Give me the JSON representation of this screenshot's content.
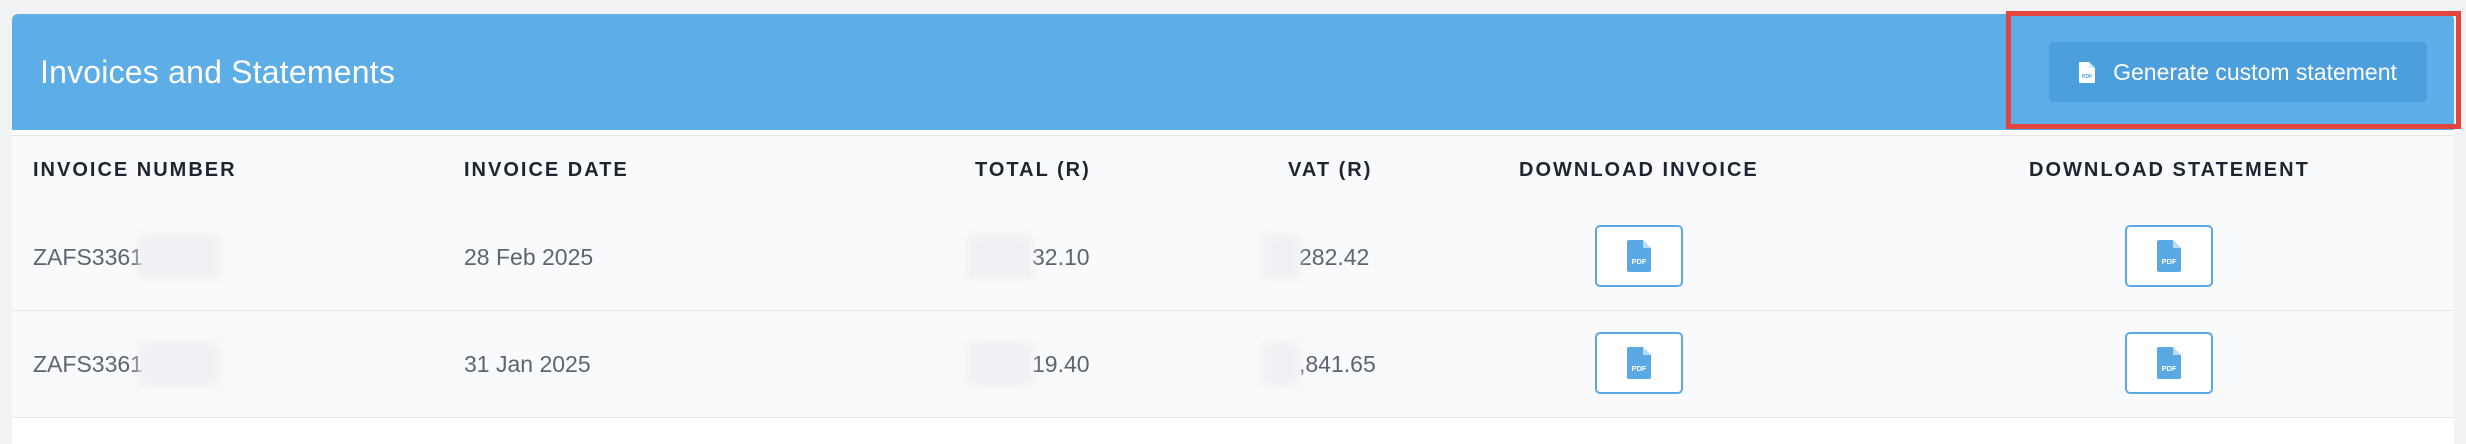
{
  "header": {
    "title": "Invoices and Statements",
    "generate_button_label": "Generate custom statement"
  },
  "table": {
    "columns": [
      "INVOICE NUMBER",
      "INVOICE DATE",
      "TOTAL (R)",
      "VAT (R)",
      "DOWNLOAD INVOICE",
      "DOWNLOAD STATEMENT"
    ],
    "rows": [
      {
        "invoice_number": "ZAFS3361",
        "invoice_date": "28 Feb 2025",
        "total": "32.10",
        "vat": "282.42"
      },
      {
        "invoice_number": "ZAFS3361",
        "invoice_date": "31 Jan 2025",
        "total": "19.40",
        "vat": ",841.65"
      }
    ]
  },
  "icons": {
    "pdf": "pdf-file-icon",
    "pdf_label": "PDF"
  },
  "colors": {
    "header_bg": "#5dade7",
    "button_bg": "#4b9fdc",
    "highlight": "#e2453d"
  }
}
